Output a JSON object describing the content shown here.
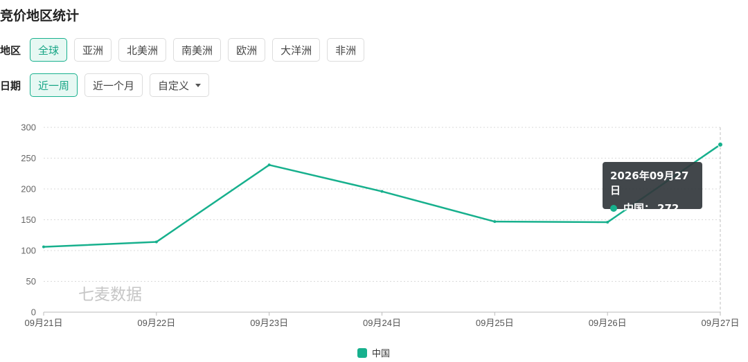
{
  "page": {
    "title": "竞价地区统计"
  },
  "filters": {
    "region": {
      "label": "地区",
      "options": [
        "全球",
        "亚洲",
        "北美洲",
        "南美洲",
        "欧洲",
        "大洋洲",
        "非洲"
      ],
      "selected": "全球"
    },
    "date": {
      "label": "日期",
      "options": [
        "近一周",
        "近一个月"
      ],
      "custom_label": "自定义",
      "selected": "近一周"
    }
  },
  "colors": {
    "accent": "#17b08d",
    "tooltip_bg": "#32373c"
  },
  "tooltip": {
    "date": "2026年09月27日",
    "series": "中国",
    "separator": "：",
    "value": "272"
  },
  "chart_data": {
    "type": "line",
    "categories": [
      "09月21日",
      "09月22日",
      "09月23日",
      "09月24日",
      "09月25日",
      "09月26日",
      "09月27日"
    ],
    "series": [
      {
        "name": "中国",
        "values": [
          106,
          114,
          239,
          196,
          147,
          146,
          272
        ]
      }
    ],
    "ylim": [
      0,
      300
    ],
    "yticks": [
      0,
      50,
      100,
      150,
      200,
      250,
      300
    ],
    "grid": true,
    "legend": "bottom-center",
    "watermark": "七麦数据"
  }
}
